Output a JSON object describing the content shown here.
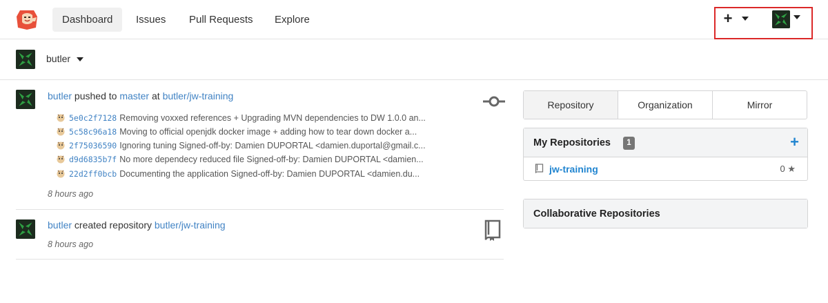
{
  "nav": {
    "items": [
      {
        "label": "Dashboard",
        "active": true
      },
      {
        "label": "Issues"
      },
      {
        "label": "Pull Requests"
      },
      {
        "label": "Explore"
      }
    ],
    "plus_symbol": "+",
    "logo_icon": "gogs-logo-icon",
    "user_menu_icon": "user-avatar-icon"
  },
  "context": {
    "user": "butler"
  },
  "feed": [
    {
      "user": "butler",
      "action": "pushed to",
      "branch": "master",
      "at": "at",
      "repo": "butler/jw-training",
      "icon": "commit-icon",
      "commits": [
        {
          "sha": "5e0c2f7128",
          "message": "Removing voxxed references + Upgrading MVN dependencies to DW 1.0.0 an..."
        },
        {
          "sha": "5c58c96a18",
          "message": "Moving to official openjdk docker image + adding how to tear down docker a..."
        },
        {
          "sha": "2f75036590",
          "message": "Ignoring tuning Signed-off-by: Damien DUPORTAL <damien.duportal@gmail.c..."
        },
        {
          "sha": "d9d6835b7f",
          "message": "No more dependecy reduced file Signed-off-by: Damien DUPORTAL <damien..."
        },
        {
          "sha": "22d2ff0bcb",
          "message": "Documenting the application Signed-off-by: Damien DUPORTAL <damien.du..."
        }
      ],
      "time": "8 hours ago"
    },
    {
      "user": "butler",
      "action": "created repository",
      "repo": "butler/jw-training",
      "icon": "repo-book-icon",
      "time": "8 hours ago"
    }
  ],
  "right_panel": {
    "tabs": [
      "Repository",
      "Organization",
      "Mirror"
    ],
    "my_repos": {
      "title": "My Repositories",
      "count": "1",
      "add_symbol": "+",
      "items": [
        {
          "name": "jw-training",
          "stars": "0"
        }
      ]
    },
    "collab": {
      "title": "Collaborative Repositories"
    }
  },
  "colors": {
    "link": "#4183c4",
    "accent": "#2185d0",
    "highlight": "#db2828"
  }
}
